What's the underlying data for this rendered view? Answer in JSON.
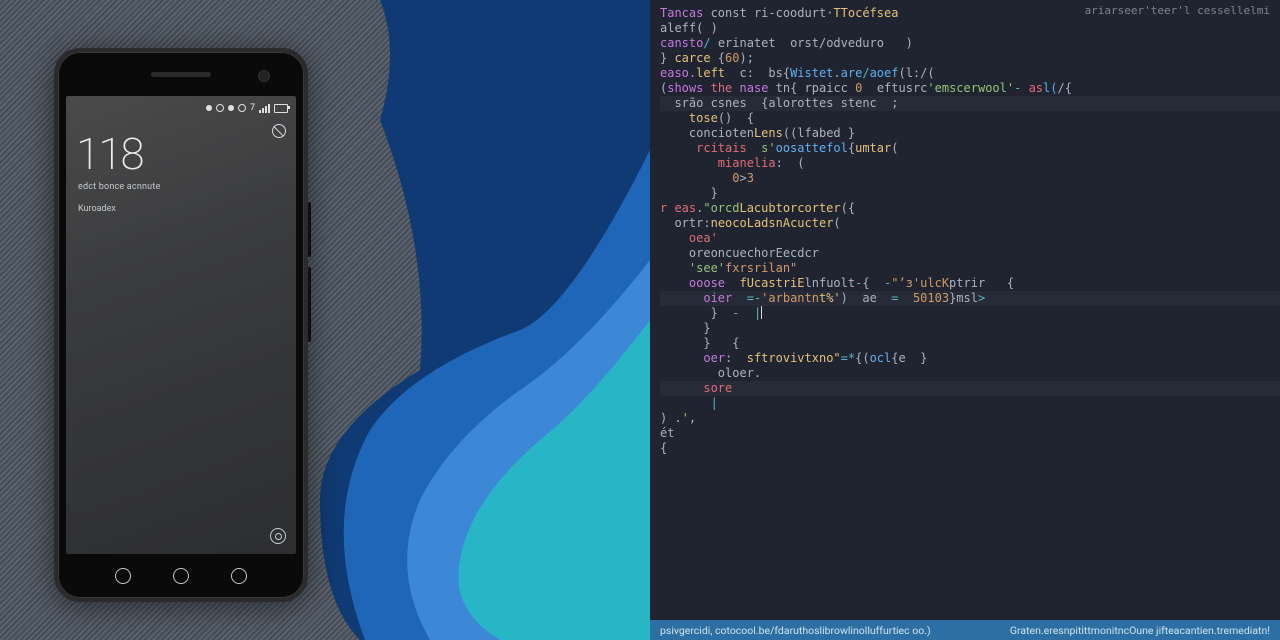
{
  "phone": {
    "status": {
      "network_label": "7"
    },
    "lockscreen": {
      "time": "118",
      "date_text": "edct bonce acnnute",
      "notification_text": "Kuroadex"
    },
    "nav_buttons": [
      "back",
      "home",
      "recents"
    ]
  },
  "editor": {
    "top_right": "ariarseer'teer'l cessellelmi",
    "lines": [
      {
        "seg": [
          [
            "kw",
            "Tancas"
          ],
          [
            "p",
            " const "
          ],
          [
            "id",
            "ri-coodurt"
          ],
          [
            "p",
            "·"
          ],
          [
            "type",
            "TTocéfsea"
          ]
        ]
      },
      {
        "seg": [
          [
            "id",
            "aleff"
          ],
          [
            "p",
            "( )"
          ]
        ]
      },
      {
        "seg": [
          [
            "kw",
            "cansto"
          ],
          [
            "op",
            "/"
          ],
          [
            "p",
            " erinatet  orst/"
          ],
          [
            "id",
            "odveduro"
          ],
          [
            "p",
            "   )"
          ]
        ]
      },
      {
        "seg": [
          [
            "p",
            "} "
          ],
          [
            "fn",
            "carce"
          ],
          [
            "p",
            " {"
          ],
          [
            "num",
            "60"
          ],
          [
            "p",
            ");"
          ]
        ]
      },
      {
        "seg": [
          [
            "kw",
            "easo."
          ],
          [
            "type",
            "left"
          ],
          [
            "p",
            "  c:  bs"
          ],
          [
            "id",
            "{"
          ],
          [
            "fn2",
            "Wistet"
          ],
          [
            "p",
            "."
          ],
          [
            "fn2",
            "are"
          ],
          [
            "op",
            "/"
          ],
          [
            "fn2",
            "aoef"
          ],
          [
            "p",
            "(l:/("
          ]
        ]
      },
      {
        "seg": [
          [
            "p",
            "("
          ],
          [
            "kw",
            "shows"
          ],
          [
            "p",
            " "
          ],
          [
            "kw2",
            "the"
          ],
          [
            "p",
            " "
          ],
          [
            "kw",
            "nase"
          ],
          [
            "p",
            " tn{ "
          ],
          [
            "id",
            "rpaicc"
          ],
          [
            "p",
            " "
          ],
          [
            "num",
            "0"
          ],
          [
            "p",
            "  eftusrc"
          ],
          [
            "str",
            "'emscerwool'"
          ],
          [
            "op",
            "-"
          ],
          [
            "p",
            " "
          ],
          [
            "prop",
            "as"
          ],
          [
            "fn2",
            "l("
          ],
          [
            "p",
            "/{"
          ]
        ]
      },
      {
        "hl": true,
        "seg": [
          [
            "p",
            "  "
          ],
          [
            "id",
            "srão csnes"
          ],
          [
            "p",
            "  {"
          ],
          [
            "id",
            "alorottes"
          ],
          [
            "p",
            " "
          ],
          [
            "id",
            "stenc"
          ],
          [
            "p",
            "  ;"
          ]
        ]
      },
      {
        "seg": [
          [
            "p",
            "    "
          ],
          [
            "fn",
            "tose"
          ],
          [
            "p",
            "()  {"
          ]
        ]
      },
      {
        "seg": [
          [
            "p",
            "    "
          ],
          [
            "id",
            "concioten"
          ],
          [
            "fn",
            "Lens"
          ],
          [
            "p",
            "(("
          ],
          [
            "id",
            "lfabed"
          ],
          [
            "p",
            " }"
          ]
        ]
      },
      {
        "seg": [
          [
            "p",
            "     "
          ],
          [
            "prop",
            "rcitais"
          ],
          [
            "p",
            "  "
          ],
          [
            "str",
            "s'"
          ],
          [
            "fn2",
            "oosattefol"
          ],
          [
            "p",
            "{"
          ],
          [
            "fn",
            "umtar"
          ],
          [
            "p",
            "("
          ]
        ]
      },
      {
        "seg": [
          [
            "p",
            "        "
          ],
          [
            "prop",
            "mianelia"
          ],
          [
            "p",
            ":  ("
          ]
        ]
      },
      {
        "seg": [
          [
            "p",
            "          "
          ],
          [
            "num",
            "0"
          ],
          [
            "p",
            ">"
          ],
          [
            "num",
            "3"
          ]
        ]
      },
      {
        "seg": [
          [
            "p",
            "       }"
          ]
        ]
      },
      {
        "seg": [
          [
            "prop",
            "r eas"
          ],
          [
            "p",
            "."
          ],
          [
            "str",
            "\"orcd"
          ],
          [
            "fn",
            "Lacubtorcorter"
          ],
          [
            "p",
            "({"
          ]
        ]
      },
      {
        "seg": [
          [
            "p",
            "  "
          ],
          [
            "id",
            "ortr"
          ],
          [
            "p",
            ":"
          ],
          [
            "fn",
            "neocoLadsnAcucter"
          ],
          [
            "p",
            "("
          ]
        ]
      },
      {
        "seg": [
          [
            "p",
            "    "
          ],
          [
            "prop",
            "oea'"
          ]
        ]
      },
      {
        "seg": [
          [
            "p",
            "    "
          ],
          [
            "id",
            "oreoncuechorEecdcr"
          ]
        ]
      },
      {
        "seg": [
          [
            "p",
            "    "
          ],
          [
            "str",
            "'see'"
          ],
          [
            "str2",
            "fxrsrilan\""
          ]
        ]
      },
      {
        "seg": [
          [
            "p",
            "    "
          ],
          [
            "kw",
            "ooose"
          ],
          [
            "p",
            "  "
          ],
          [
            "fn",
            "fUcastriE"
          ],
          [
            "id",
            "lnfuolt"
          ],
          [
            "op",
            "-"
          ],
          [
            "p",
            "{  "
          ],
          [
            "op",
            "-"
          ],
          [
            "str2",
            "\"’з'ulcK"
          ],
          [
            "id",
            "ptrir"
          ],
          [
            "p",
            "   {"
          ]
        ]
      },
      {
        "hl": true,
        "seg": [
          [
            "p",
            "      "
          ],
          [
            "kw",
            "oier"
          ],
          [
            "p",
            "  "
          ],
          [
            "op",
            "=-"
          ],
          [
            "str2",
            "'arbantn"
          ],
          [
            "fn",
            "t%'"
          ],
          [
            "p",
            ")  "
          ],
          [
            "id",
            "ae"
          ],
          [
            "p",
            "  "
          ],
          [
            "op",
            "="
          ],
          [
            "p",
            "  "
          ],
          [
            "num",
            "50103"
          ],
          [
            "p",
            "}"
          ],
          [
            "id",
            "msl"
          ],
          [
            "op",
            ">"
          ]
        ]
      },
      {
        "seg": [
          [
            "p",
            "       }  "
          ],
          [
            "op",
            "-"
          ],
          [
            "p",
            "  "
          ],
          [
            "op",
            "|"
          ],
          [
            "cursor",
            ""
          ]
        ]
      },
      {
        "seg": [
          [
            "p",
            "      }"
          ]
        ]
      },
      {
        "seg": [
          [
            "p",
            ""
          ]
        ]
      },
      {
        "seg": [
          [
            "p",
            "      }   {"
          ]
        ]
      },
      {
        "seg": [
          [
            "p",
            "      "
          ],
          [
            "kw",
            "oer"
          ],
          [
            "p",
            ":  "
          ],
          [
            "fn",
            "sftrovivtxno\""
          ],
          [
            "op",
            "=*"
          ],
          [
            "p",
            "{("
          ],
          [
            "fn2",
            "ocl"
          ],
          [
            "p",
            "{"
          ],
          [
            "id",
            "e"
          ],
          [
            "p",
            "  }"
          ]
        ]
      },
      {
        "seg": [
          [
            "p",
            "        "
          ],
          [
            "id",
            "oloer"
          ],
          [
            "p",
            "."
          ]
        ]
      },
      {
        "hl": true,
        "seg": [
          [
            "p",
            "      "
          ],
          [
            "kw2",
            "sore"
          ]
        ]
      },
      {
        "seg": [
          [
            "p",
            ""
          ]
        ]
      },
      {
        "seg": [
          [
            "p",
            "       "
          ],
          [
            "op",
            "|"
          ]
        ]
      },
      {
        "seg": [
          [
            "p",
            ") ."
          ],
          [
            "str",
            "'"
          ],
          [
            "p",
            ","
          ]
        ]
      },
      {
        "seg": [
          [
            "id",
            "ét"
          ]
        ]
      },
      {
        "seg": [
          [
            "p",
            "{"
          ]
        ]
      }
    ]
  },
  "statusbar": {
    "left": "psivgercidi, cotocool.be/fdaruthoslibrowlinolluffurtiec oo.)",
    "right": "Graten.eresnpitittmonitncOune jifteacantien.tremediatn!"
  }
}
